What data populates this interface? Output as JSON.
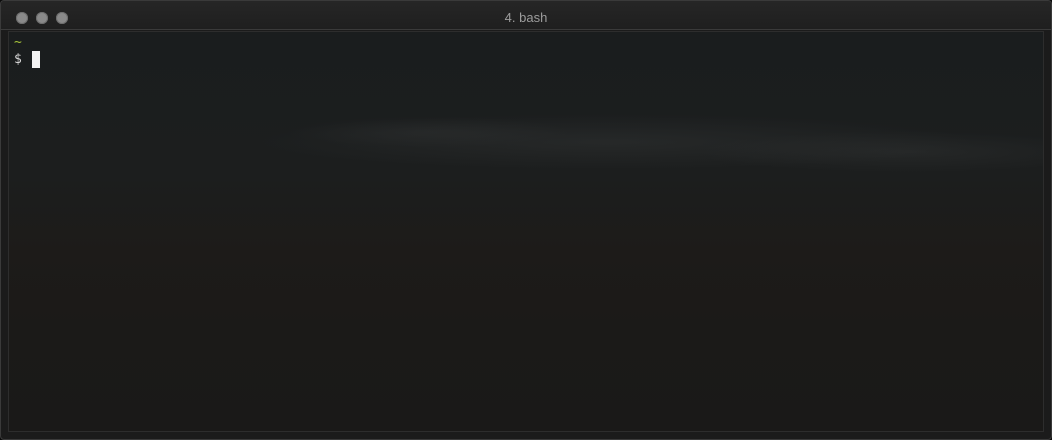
{
  "window": {
    "title": "4. bash",
    "traffic_lights": [
      "close-icon",
      "minimize-icon",
      "zoom-icon"
    ],
    "colors": {
      "titlebar": "#222222",
      "title_text": "#9c9c9c",
      "traffic_light": "#8a8a8a"
    }
  },
  "terminal": {
    "cwd": "~",
    "prompt": "$",
    "input": "",
    "colors": {
      "cwd": "#a7c43b",
      "prompt": "#d8d8d8",
      "cursor": "#f2f2f2"
    }
  }
}
